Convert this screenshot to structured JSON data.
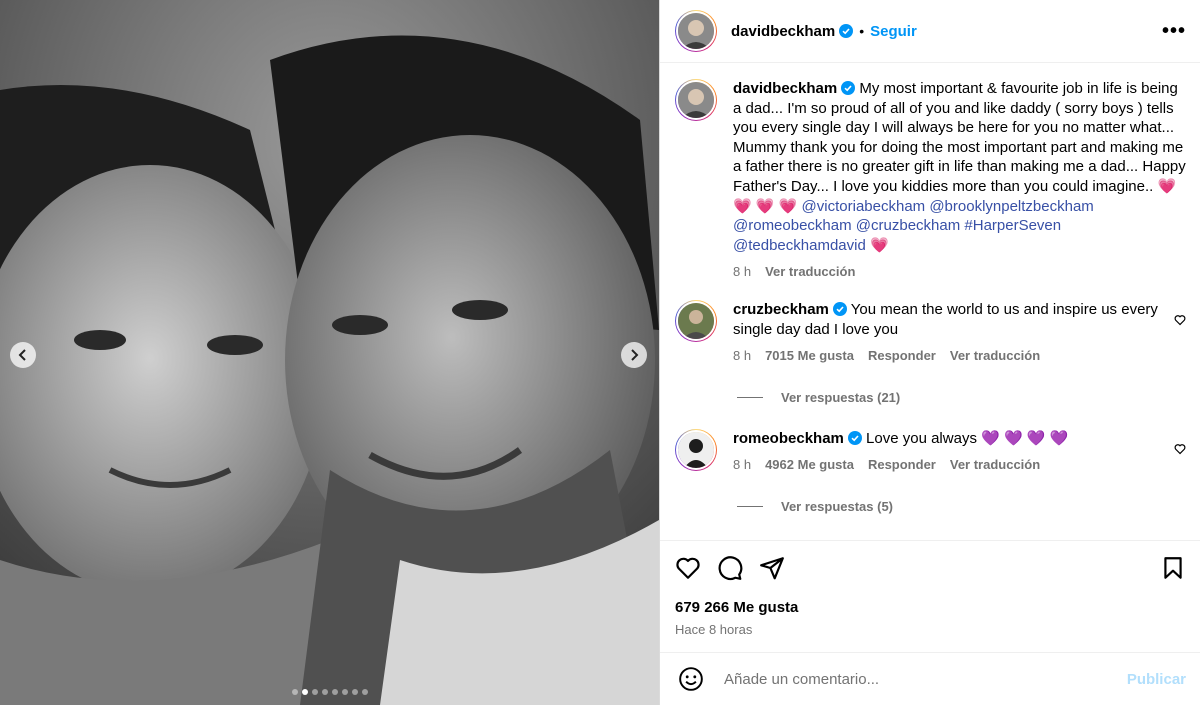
{
  "post": {
    "username": "davidbeckham",
    "follow_label": "Seguir",
    "caption_text": "My most important & favourite job in life is being a dad... I'm so proud of all of you and like daddy ( sorry boys ) tells you every single day I will always be here for you no matter what... Mummy thank you for doing the most important part and making me a father there is no greater gift in life than making me a dad... Happy Father's Day... I love you kiddies more than you could imagine.. ",
    "caption_hearts": "💗 💗 💗 💗",
    "mentions": [
      "@victoriabeckham",
      "@brooklynpeltzbeckham",
      "@romeobeckham",
      "@cruzbeckham",
      "#HarperSeven",
      "@tedbeckhamdavid"
    ],
    "end_heart": "💗",
    "caption_time": "8 h",
    "caption_translate": "Ver traducción"
  },
  "comments": [
    {
      "username": "cruzbeckham",
      "text": "You mean the world to us and inspire us every single day dad I love you",
      "time": "8 h",
      "likes": "7015 Me gusta",
      "reply": "Responder",
      "translate": "Ver traducción",
      "replies": "Ver respuestas (21)"
    },
    {
      "username": "romeobeckham",
      "text": "Love you always ",
      "emoji": "💜 💜 💜 💜",
      "time": "8 h",
      "likes": "4962 Me gusta",
      "reply": "Responder",
      "translate": "Ver traducción",
      "replies": "Ver respuestas (5)"
    }
  ],
  "footer": {
    "likes": "679 266 Me gusta",
    "time": "Hace 8 horas",
    "comment_placeholder": "Añade un comentario...",
    "publish": "Publicar"
  },
  "carousel": {
    "slides": 8,
    "active_index": 1
  },
  "colors": {
    "link": "#0095f6",
    "mention": "#3850a6",
    "muted": "#737373"
  },
  "icons": [
    "chevron-left-icon",
    "chevron-right-icon",
    "verified-icon",
    "more-icon",
    "heart-icon",
    "comment-icon",
    "share-icon",
    "bookmark-icon",
    "emoji-icon"
  ]
}
